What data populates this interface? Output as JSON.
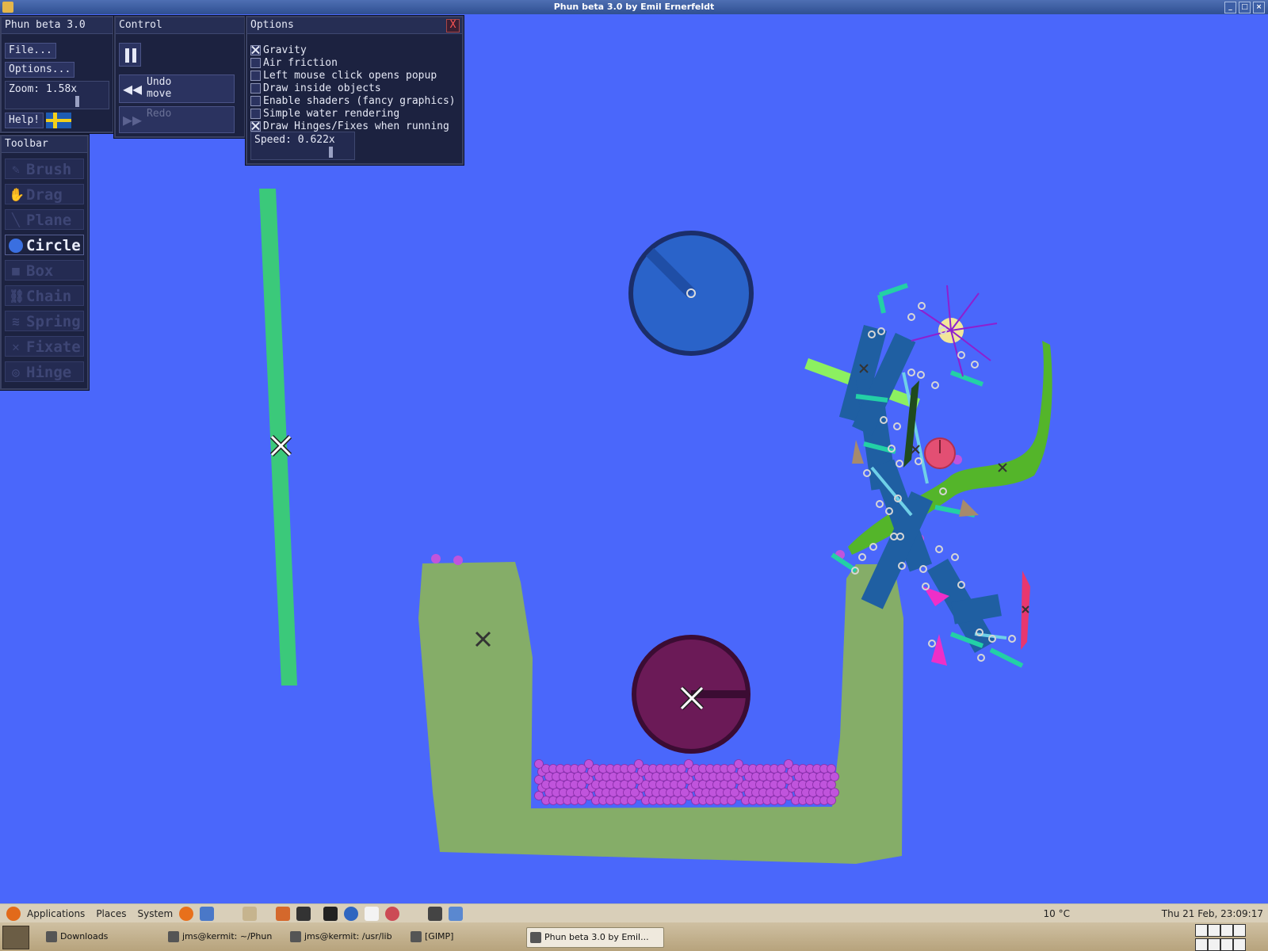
{
  "window": {
    "title": "Phun beta 3.0 by Emil Ernerfeldt"
  },
  "main_panel": {
    "title": "Phun beta 3.0",
    "file_button": "File...",
    "options_button": "Options...",
    "zoom_label": "Zoom: 1.58x",
    "help_button": "Help!"
  },
  "control_panel": {
    "title": "Control",
    "undo_line1": "Undo",
    "undo_line2": "move",
    "redo_label": "Redo"
  },
  "options_panel": {
    "title": "Options",
    "close_glyph": "X",
    "items": [
      {
        "label": "Gravity",
        "checked": true
      },
      {
        "label": "Air friction",
        "checked": false
      },
      {
        "label": "Left mouse click opens popup",
        "checked": false
      },
      {
        "label": "Draw inside objects",
        "checked": false
      },
      {
        "label": "Enable shaders (fancy graphics)",
        "checked": false
      },
      {
        "label": "Simple water rendering",
        "checked": false
      },
      {
        "label": "Draw Hinges/Fixes when running",
        "checked": true
      }
    ],
    "speed_label": "Speed: 0.622x"
  },
  "toolbar": {
    "title": "Toolbar",
    "tools": [
      {
        "label": "Brush",
        "icon": "brush-icon",
        "active": false
      },
      {
        "label": "Drag",
        "icon": "hand-icon",
        "active": false
      },
      {
        "label": "Plane",
        "icon": "plane-icon",
        "active": false
      },
      {
        "label": "Circle",
        "icon": "circle-icon",
        "active": true
      },
      {
        "label": "Box",
        "icon": "box-icon",
        "active": false
      },
      {
        "label": "Chain",
        "icon": "chain-icon",
        "active": false
      },
      {
        "label": "Spring",
        "icon": "spring-icon",
        "active": false
      },
      {
        "label": "Fixate",
        "icon": "fixate-icon",
        "active": false
      },
      {
        "label": "Hinge",
        "icon": "hinge-icon",
        "active": false
      }
    ]
  },
  "colors": {
    "background": "#4a67fb",
    "ground": "#85ad68",
    "pole": "#3bc97a",
    "blue_wheel": "#2a63c9",
    "purple_wheel": "#6b1a57",
    "balls": "#c054dc"
  },
  "taskbar": {
    "menus": [
      "Applications",
      "Places",
      "System"
    ],
    "tasks": [
      {
        "label": "Downloads",
        "active": false
      },
      {
        "label": "jms@kermit: ~/Phun",
        "active": false
      },
      {
        "label": "jms@kermit: /usr/lib",
        "active": false
      },
      {
        "label": "[GIMP]",
        "active": false
      },
      {
        "label": "Phun beta 3.0 by Emil...",
        "active": true
      }
    ],
    "weather": "10 °C",
    "clock": "Thu 21 Feb, 23:09:17"
  }
}
